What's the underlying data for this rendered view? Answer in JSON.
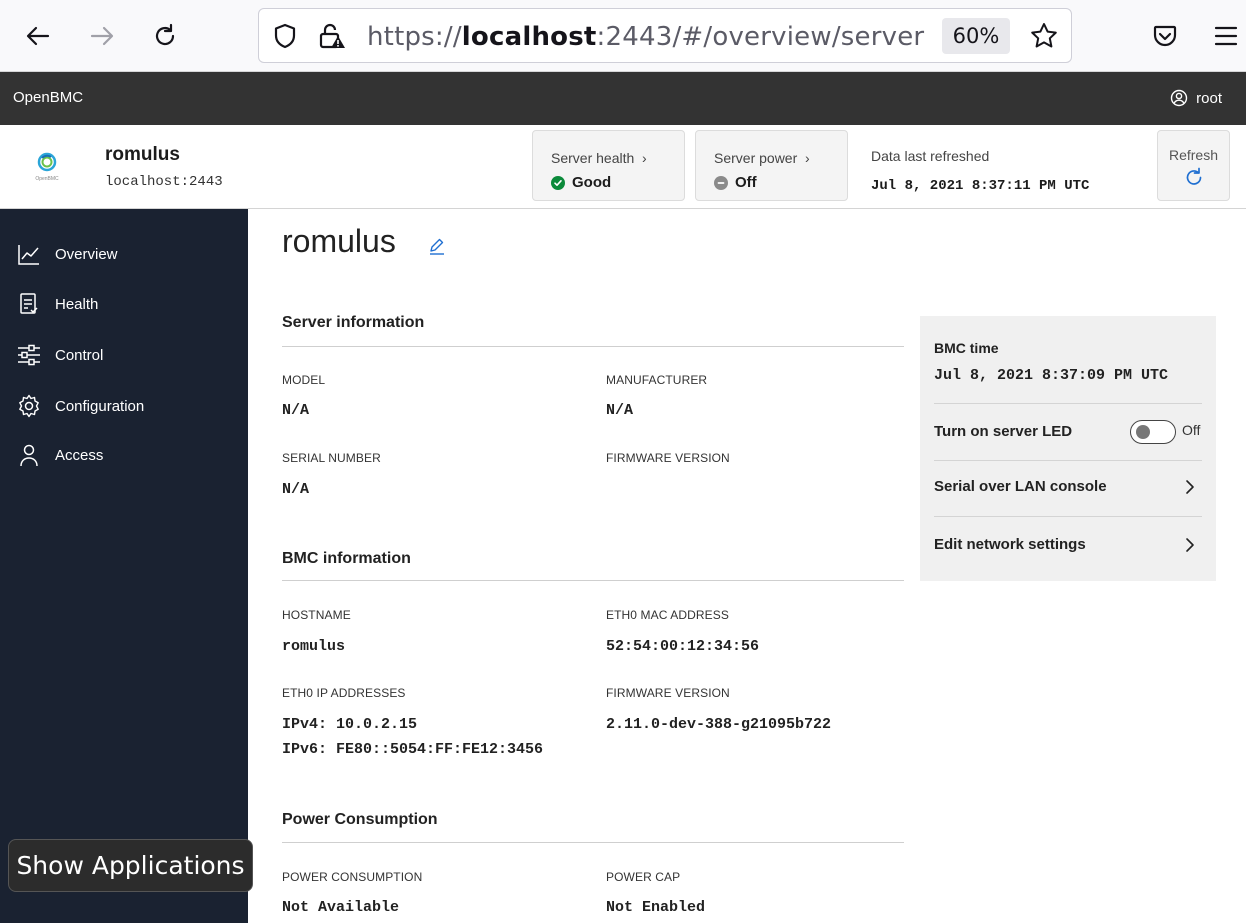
{
  "browser": {
    "url_prefix": "https://",
    "url_host": "localhost",
    "url_rest": ":2443/#/overview/server",
    "zoom": "60%"
  },
  "app_header": {
    "brand": "OpenBMC",
    "user": "root"
  },
  "status_bar": {
    "system_name": "romulus",
    "system_host": "localhost:2443",
    "logo_text": "OpenBMC",
    "server_health": {
      "label": "Server health",
      "value": "Good",
      "color": "#0b8a3a"
    },
    "server_power": {
      "label": "Server power",
      "value": "Off",
      "color": "#8a8a8a"
    },
    "refresh_meta": {
      "label": "Data last refreshed",
      "value": "Jul 8, 2021 8:37:11 PM UTC"
    },
    "refresh_button": "Refresh"
  },
  "sidebar": {
    "items": [
      {
        "label": "Overview",
        "icon": "chart-line-icon"
      },
      {
        "label": "Health",
        "icon": "health-list-icon"
      },
      {
        "label": "Control",
        "icon": "sliders-icon"
      },
      {
        "label": "Configuration",
        "icon": "gear-icon"
      },
      {
        "label": "Access",
        "icon": "user-icon"
      }
    ]
  },
  "overlay": {
    "show_applications": "Show Applications"
  },
  "main": {
    "title": "romulus",
    "server_info": {
      "heading": "Server information",
      "model_label": "MODEL",
      "model": "N/A",
      "manufacturer_label": "MANUFACTURER",
      "manufacturer": "N/A",
      "serial_label": "SERIAL NUMBER",
      "serial": "N/A",
      "firmware_label": "FIRMWARE VERSION",
      "firmware": ""
    },
    "bmc_info": {
      "heading": "BMC information",
      "hostname_label": "HOSTNAME",
      "hostname": "romulus",
      "mac_label": "ETH0 MAC ADDRESS",
      "mac": "52:54:00:12:34:56",
      "ip_label": "ETH0 IP ADDRESSES",
      "ipv4": "IPv4: 10.0.2.15",
      "ipv6": "IPv6: FE80::5054:FF:FE12:3456",
      "firmware_label": "FIRMWARE VERSION",
      "firmware": "2.11.0-dev-388-g21095b722"
    },
    "power": {
      "heading": "Power Consumption",
      "consumption_label": "POWER CONSUMPTION",
      "consumption": "Not Available",
      "cap_label": "POWER CAP",
      "cap": "Not Enabled"
    },
    "quick_panel": {
      "bmc_time_label": "BMC time",
      "bmc_time": "Jul 8, 2021 8:37:09 PM UTC",
      "led_label": "Turn on server LED",
      "led_state": "Off",
      "sol_label": "Serial over LAN console",
      "network_label": "Edit network settings"
    }
  }
}
